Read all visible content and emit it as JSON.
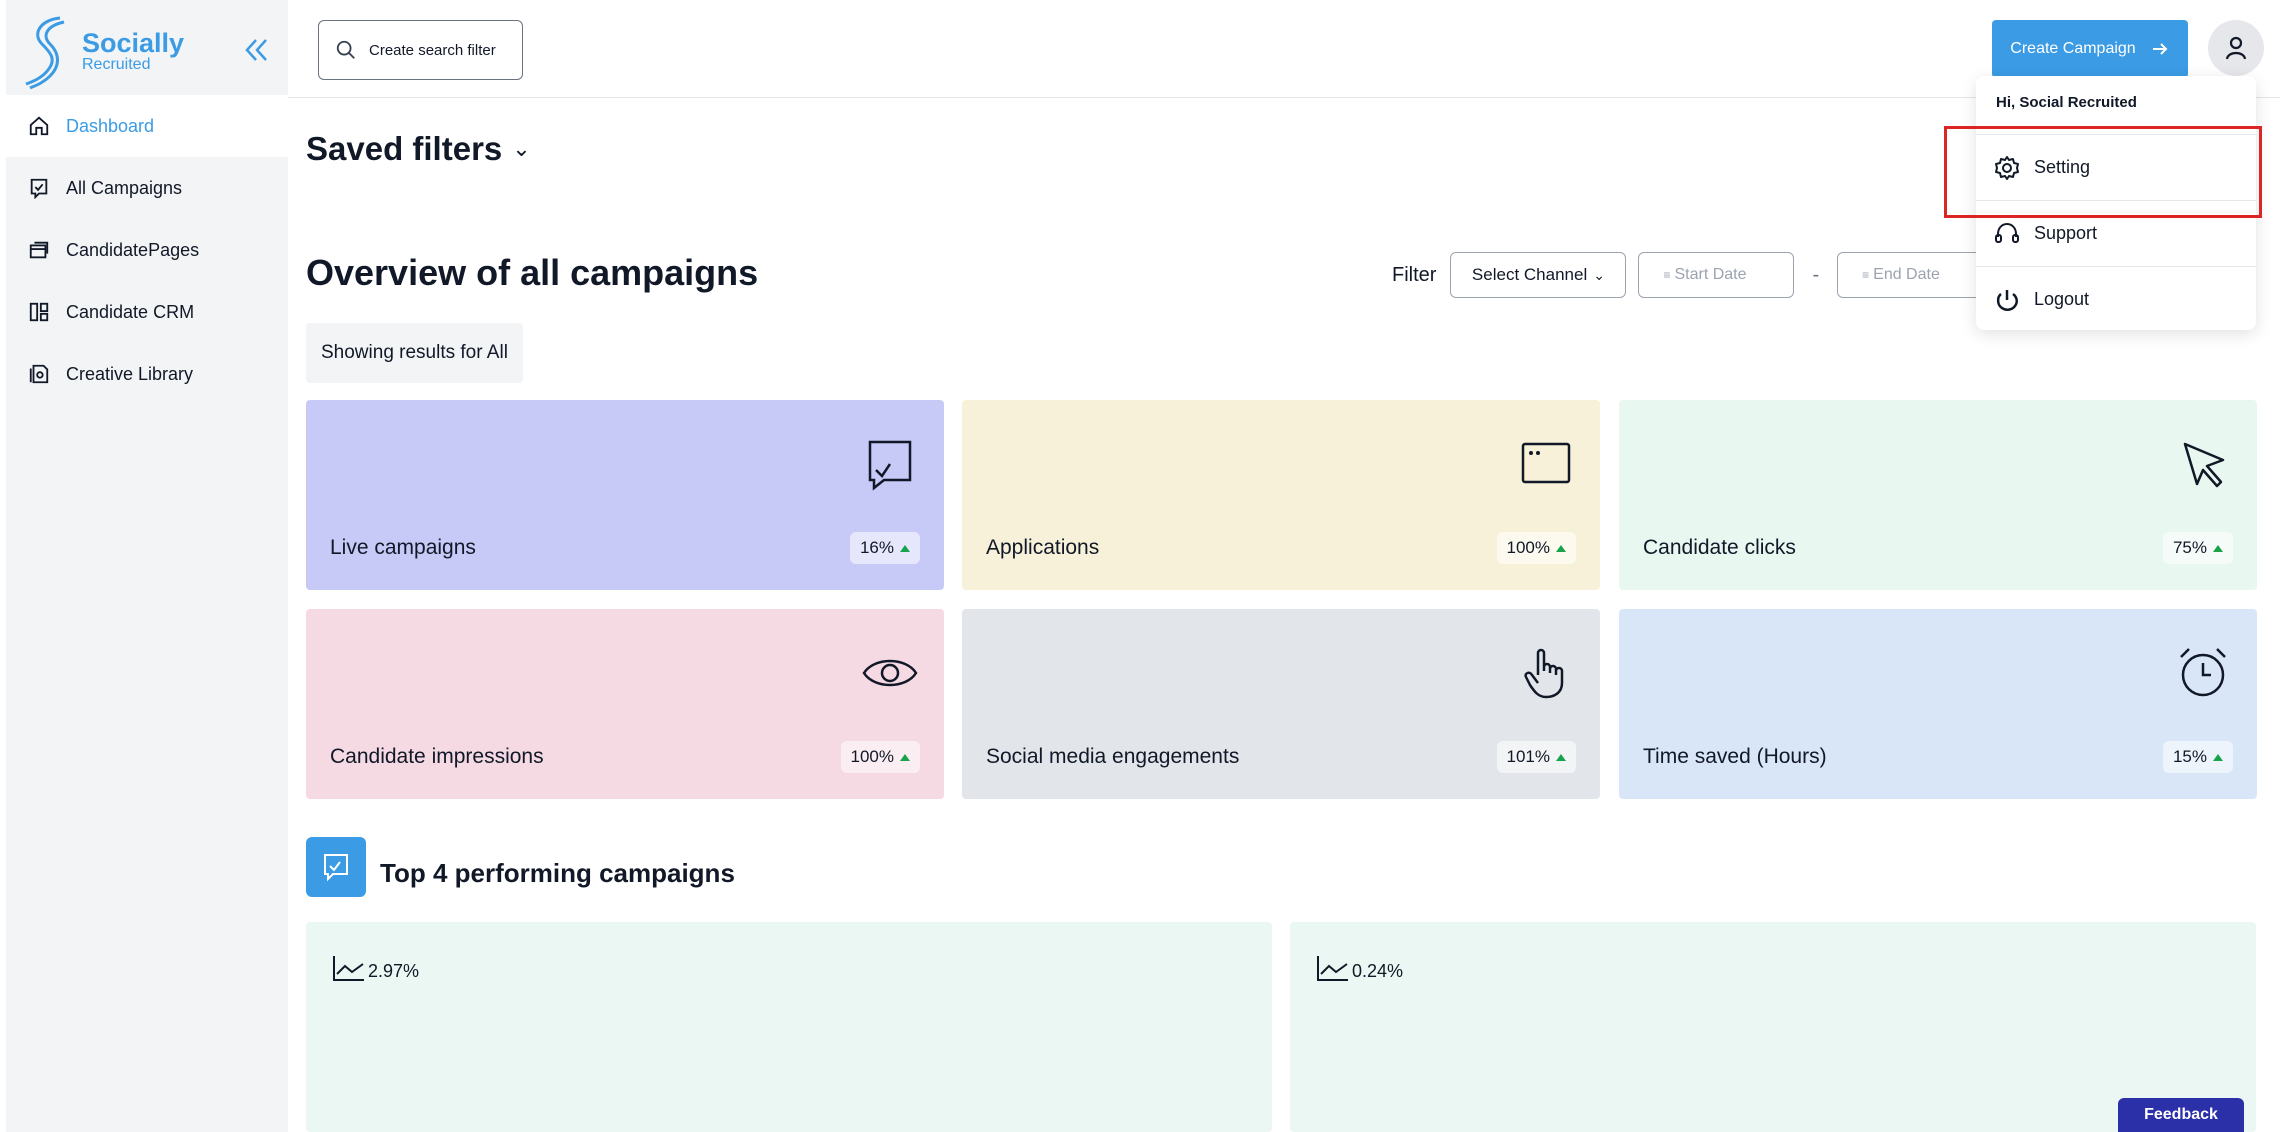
{
  "brand": {
    "title": "Socially",
    "subtitle": "Recruited",
    "color": "#3b9be4"
  },
  "sidebar": {
    "items": [
      {
        "label": "Dashboard",
        "icon": "home-icon",
        "active": true
      },
      {
        "label": "All Campaigns",
        "icon": "campaign-icon"
      },
      {
        "label": "CandidatePages",
        "icon": "pages-icon"
      },
      {
        "label": "Candidate CRM",
        "icon": "crm-icon"
      },
      {
        "label": "Creative Library",
        "icon": "library-icon"
      }
    ]
  },
  "header": {
    "search_label": "Create search filter",
    "create_label": "Create Campaign"
  },
  "main": {
    "saved_filters": "Saved filters",
    "overview_title": "Overview of all campaigns",
    "results_text": "Showing results for All",
    "filter": {
      "label": "Filter",
      "channel": "Select Channel",
      "start_placeholder": "Start Date",
      "end_placeholder": "End Date",
      "separator": "-"
    },
    "cards": [
      {
        "label": "Live campaigns",
        "percent": "16%",
        "icon": "campaign-check-icon",
        "color": "#c7c9f7"
      },
      {
        "label": "Applications",
        "percent": "100%",
        "icon": "window-icon",
        "color": "#f8f1d9"
      },
      {
        "label": "Candidate clicks",
        "percent": "75%",
        "icon": "cursor-icon",
        "color": "#e9f7f1"
      },
      {
        "label": "Candidate impressions",
        "percent": "100%",
        "icon": "eye-icon",
        "color": "#f5d9e3"
      },
      {
        "label": "Social media engagements",
        "percent": "101%",
        "icon": "hand-pointer-icon",
        "color": "#e2e6ea"
      },
      {
        "label": "Time saved (Hours)",
        "percent": "15%",
        "icon": "alarm-clock-icon",
        "color": "#d8e6f7"
      }
    ],
    "top_title": "Top 4 performing campaigns",
    "performance": [
      {
        "value": "2.97%"
      },
      {
        "value": "0.24%"
      }
    ],
    "feedback_label": "Feedback"
  },
  "user_menu": {
    "greeting": "Hi, Social Recruited",
    "items": [
      {
        "label": "Setting",
        "icon": "gear-icon"
      },
      {
        "label": "Support",
        "icon": "headset-icon"
      },
      {
        "label": "Logout",
        "icon": "power-icon"
      }
    ]
  }
}
